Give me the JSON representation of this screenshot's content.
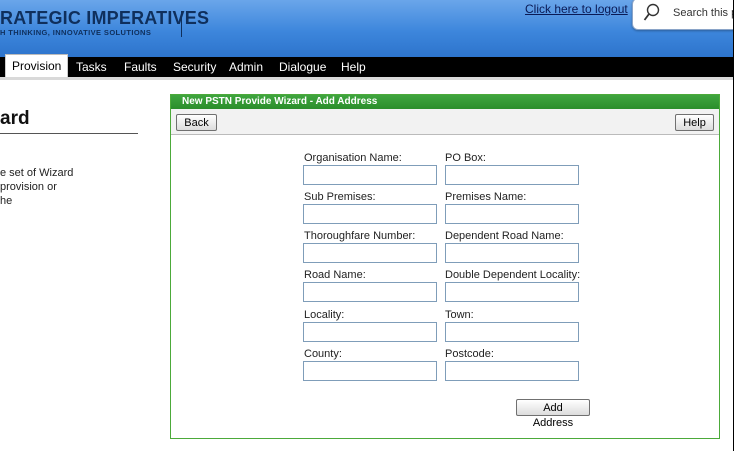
{
  "header": {
    "logo_main": "RATEGIC IMPERATIVES",
    "logo_sub": "H THINKING, INNOVATIVE SOLUTIONS",
    "logout_text": "Click here to logout",
    "search_placeholder": "Search this po"
  },
  "nav": {
    "items": [
      {
        "label": "Provision",
        "active": true
      },
      {
        "label": "Tasks"
      },
      {
        "label": "Faults"
      },
      {
        "label": "Security"
      },
      {
        "label": "Admin"
      },
      {
        "label": "Dialogue"
      },
      {
        "label": "Help"
      }
    ]
  },
  "left": {
    "title": "ard",
    "lines": [
      "e set of Wizard",
      "provision or",
      "he"
    ]
  },
  "wizard": {
    "title": "New PSTN Provide Wizard - Add Address",
    "back_label": "Back",
    "help_label": "Help",
    "submit_label": "Add Address",
    "fields": [
      {
        "label": "Organisation Name:",
        "value": ""
      },
      {
        "label": "PO Box:",
        "value": ""
      },
      {
        "label": "Sub Premises:",
        "value": ""
      },
      {
        "label": "Premises Name:",
        "value": ""
      },
      {
        "label": "Thoroughfare Number:",
        "value": ""
      },
      {
        "label": "Dependent Road Name:",
        "value": ""
      },
      {
        "label": "Road Name:",
        "value": ""
      },
      {
        "label": "Double Dependent Locality:",
        "value": ""
      },
      {
        "label": "Locality:",
        "value": ""
      },
      {
        "label": "Town:",
        "value": ""
      },
      {
        "label": "County:",
        "value": ""
      },
      {
        "label": "Postcode:",
        "value": ""
      }
    ]
  },
  "colors": {
    "header_blue": "#3d86dc",
    "nav_black": "#000000",
    "panel_green": "#3fa53f"
  }
}
